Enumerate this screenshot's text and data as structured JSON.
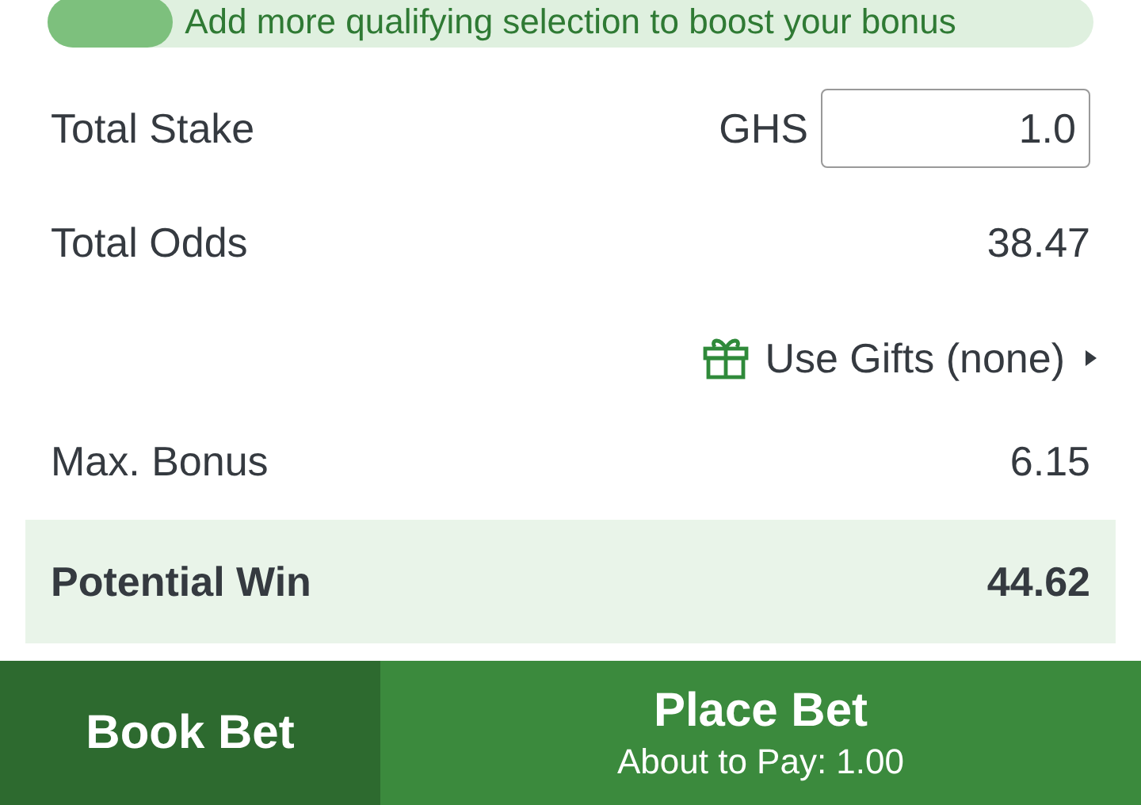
{
  "bonus_progress": {
    "text": "Add more qualifying selection to boost your bonus",
    "level": 0.12
  },
  "stake": {
    "label": "Total Stake",
    "currency": "GHS",
    "value": "1.0"
  },
  "odds": {
    "label": "Total Odds",
    "value": "38.47"
  },
  "gifts": {
    "label": "Use Gifts (none)"
  },
  "bonus": {
    "label": "Max. Bonus",
    "value": "6.15"
  },
  "potential_win": {
    "label": "Potential Win",
    "value": "44.62"
  },
  "buttons": [
    {
      "kind": "book",
      "label": "Book Bet"
    },
    {
      "kind": "place",
      "label": "Place Bet",
      "sub": "About to Pay: 1.00"
    }
  ]
}
